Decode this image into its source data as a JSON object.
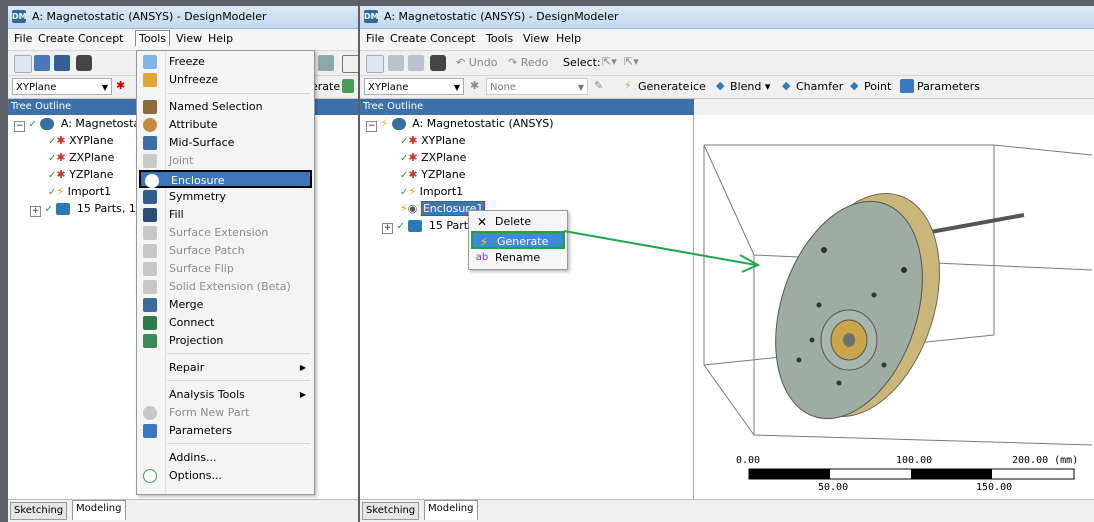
{
  "left_window": {
    "title": "A: Magnetostatic (ANSYS) - DesignModeler",
    "app_icon_text": "DM",
    "menu": [
      "File",
      "Create",
      "Concept",
      "Tools",
      "View",
      "Help"
    ],
    "plane_combo": "XYPlane",
    "generate_partial": "erate",
    "tree_header": "Tree Outline",
    "tree": [
      "A: Magnetostatic",
      "XYPlane",
      "ZXPlane",
      "YZPlane",
      "Import1",
      "15 Parts, 1"
    ],
    "tabs": [
      "Sketching",
      "Modeling"
    ]
  },
  "tools_menu": {
    "items": [
      {
        "label": "Freeze",
        "icon": "freeze-icon"
      },
      {
        "label": "Unfreeze",
        "icon": "unfreeze-icon"
      },
      {
        "label": "Named Selection",
        "icon": "named-selection-icon"
      },
      {
        "label": "Attribute",
        "icon": "attribute-icon"
      },
      {
        "label": "Mid-Surface",
        "icon": "mid-surface-icon"
      },
      {
        "label": "Joint",
        "icon": "joint-icon"
      },
      {
        "label": "Enclosure",
        "icon": "enclosure-icon"
      },
      {
        "label": "Symmetry",
        "icon": "symmetry-icon"
      },
      {
        "label": "Fill",
        "icon": "fill-icon"
      },
      {
        "label": "Surface Extension",
        "icon": "surface-extension-icon"
      },
      {
        "label": "Surface Patch",
        "icon": "surface-patch-icon"
      },
      {
        "label": "Surface Flip",
        "icon": "surface-flip-icon"
      },
      {
        "label": "Solid Extension (Beta)",
        "icon": "solid-extension-icon"
      },
      {
        "label": "Merge",
        "icon": "merge-icon"
      },
      {
        "label": "Connect",
        "icon": "connect-icon"
      },
      {
        "label": "Projection",
        "icon": "projection-icon"
      },
      {
        "label": "Repair",
        "icon": ""
      },
      {
        "label": "Analysis Tools",
        "icon": ""
      },
      {
        "label": "Form New Part",
        "icon": "form-new-part-icon"
      },
      {
        "label": "Parameters",
        "icon": "parameters-icon"
      },
      {
        "label": "Addins...",
        "icon": ""
      },
      {
        "label": "Options...",
        "icon": "options-icon"
      }
    ]
  },
  "right_window": {
    "title": "A: Magnetostatic (ANSYS) - DesignModeler",
    "app_icon_text": "DM",
    "menu": [
      "File",
      "Create",
      "Concept",
      "Tools",
      "View",
      "Help"
    ],
    "undo": "Undo",
    "redo": "Redo",
    "select_label": "Select:",
    "plane_combo": "XYPlane",
    "none_combo": "None",
    "generate": "Generate",
    "face_partial": "ice",
    "blend": "Blend",
    "chamfer": "Chamfer",
    "point": "Point",
    "parameters": "Parameters",
    "tree_header": "Tree Outline",
    "tree": [
      "A: Magnetostatic (ANSYS)",
      "XYPlane",
      "ZXPlane",
      "YZPlane",
      "Import1",
      "Enclosure1",
      "15 Part"
    ],
    "tabs": [
      "Sketching",
      "Modeling"
    ],
    "context_menu": [
      "Delete",
      "Generate",
      "Rename"
    ],
    "scale": {
      "top_labels": [
        "0.00",
        "100.00",
        "200.00 (mm)"
      ],
      "bottom_labels": [
        "50.00",
        "150.00"
      ]
    }
  },
  "colors": {
    "highlight_blue": "#3e74b8",
    "annotation_green": "#1fa64a",
    "tree_header": "#3d6fa8"
  }
}
